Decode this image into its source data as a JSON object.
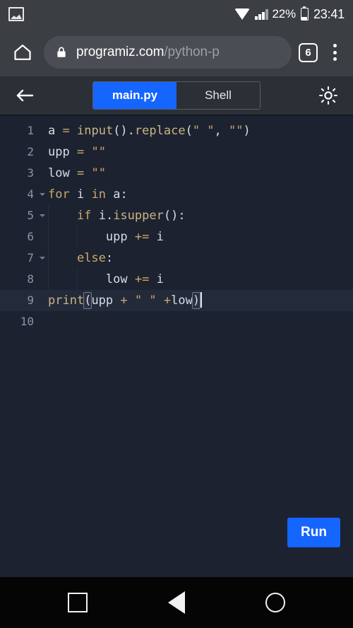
{
  "status_bar": {
    "notification_icon": "screenshot-image-icon",
    "wifi_icon": "wifi-icon",
    "signal_icon": "cellular-signal-icon",
    "battery_percent": "22%",
    "battery_icon": "battery-icon",
    "clock": "23:41"
  },
  "browser": {
    "home_icon": "home-icon",
    "lock_icon": "lock-icon",
    "url_domain": "programiz.com",
    "url_path": "/python-p",
    "url_full": "programiz.com/python-p",
    "tab_count": "6",
    "menu_icon": "three-dot-menu-icon"
  },
  "app_bar": {
    "back_icon": "back-arrow-icon",
    "theme_icon": "sun-brightness-icon",
    "tabs": [
      {
        "label": "main.py",
        "active": true
      },
      {
        "label": "Shell",
        "active": false
      }
    ]
  },
  "editor": {
    "active_line": 9,
    "lines": [
      {
        "num": "1",
        "fold": false,
        "text": "a = input().replace(\" \", \"\")"
      },
      {
        "num": "2",
        "fold": false,
        "text": "upp = \"\""
      },
      {
        "num": "3",
        "fold": false,
        "text": "low = \"\""
      },
      {
        "num": "4",
        "fold": true,
        "text": "for i in a:"
      },
      {
        "num": "5",
        "fold": true,
        "text": "    if i.isupper():"
      },
      {
        "num": "6",
        "fold": false,
        "text": "        upp += i"
      },
      {
        "num": "7",
        "fold": true,
        "text": "    else:"
      },
      {
        "num": "8",
        "fold": false,
        "text": "        low += i"
      },
      {
        "num": "9",
        "fold": false,
        "text": "print(upp + \" \" +low)"
      },
      {
        "num": "10",
        "fold": false,
        "text": ""
      }
    ],
    "line1": {
      "var": "a",
      "eq": "=",
      "fn": "input",
      "parens": "()",
      "dot": ".",
      "method": "replace",
      "open": "(",
      "str1": "\" \"",
      "comma": ",",
      "str2": "\"\"",
      "close": ")"
    },
    "line2": {
      "var": "upp",
      "eq": "=",
      "str": "\"\""
    },
    "line3": {
      "var": "low",
      "eq": "=",
      "str": "\"\""
    },
    "line4": {
      "kw": "for",
      "var": "i",
      "kw2": "in",
      "var2": "a",
      "colon": ":"
    },
    "line5": {
      "kw": "if",
      "var": "i",
      "dot": ".",
      "method": "isupper",
      "parens": "()",
      "colon": ":"
    },
    "line6": {
      "var": "upp",
      "op": "+=",
      "var2": "i"
    },
    "line7": {
      "kw": "else",
      "colon": ":"
    },
    "line8": {
      "var": "low",
      "op": "+=",
      "var2": "i"
    },
    "line9": {
      "fn": "print",
      "open": "(",
      "var": "upp",
      "op": "+",
      "str": "\" \"",
      "op2": "+",
      "var2": "low",
      "close": ")"
    }
  },
  "run_button": {
    "label": "Run"
  },
  "nav_bar": {
    "recents_icon": "square-recents-icon",
    "back_icon": "triangle-back-icon",
    "home_icon": "circle-home-icon"
  },
  "colors": {
    "accent_blue": "#1565ff",
    "editor_bg": "#1c2230",
    "chrome_bg": "#3b3f44",
    "app_bar_bg": "#2b2f36",
    "keyword": "#c8a96b",
    "string": "#c9a36a",
    "text": "#d6dae3"
  }
}
